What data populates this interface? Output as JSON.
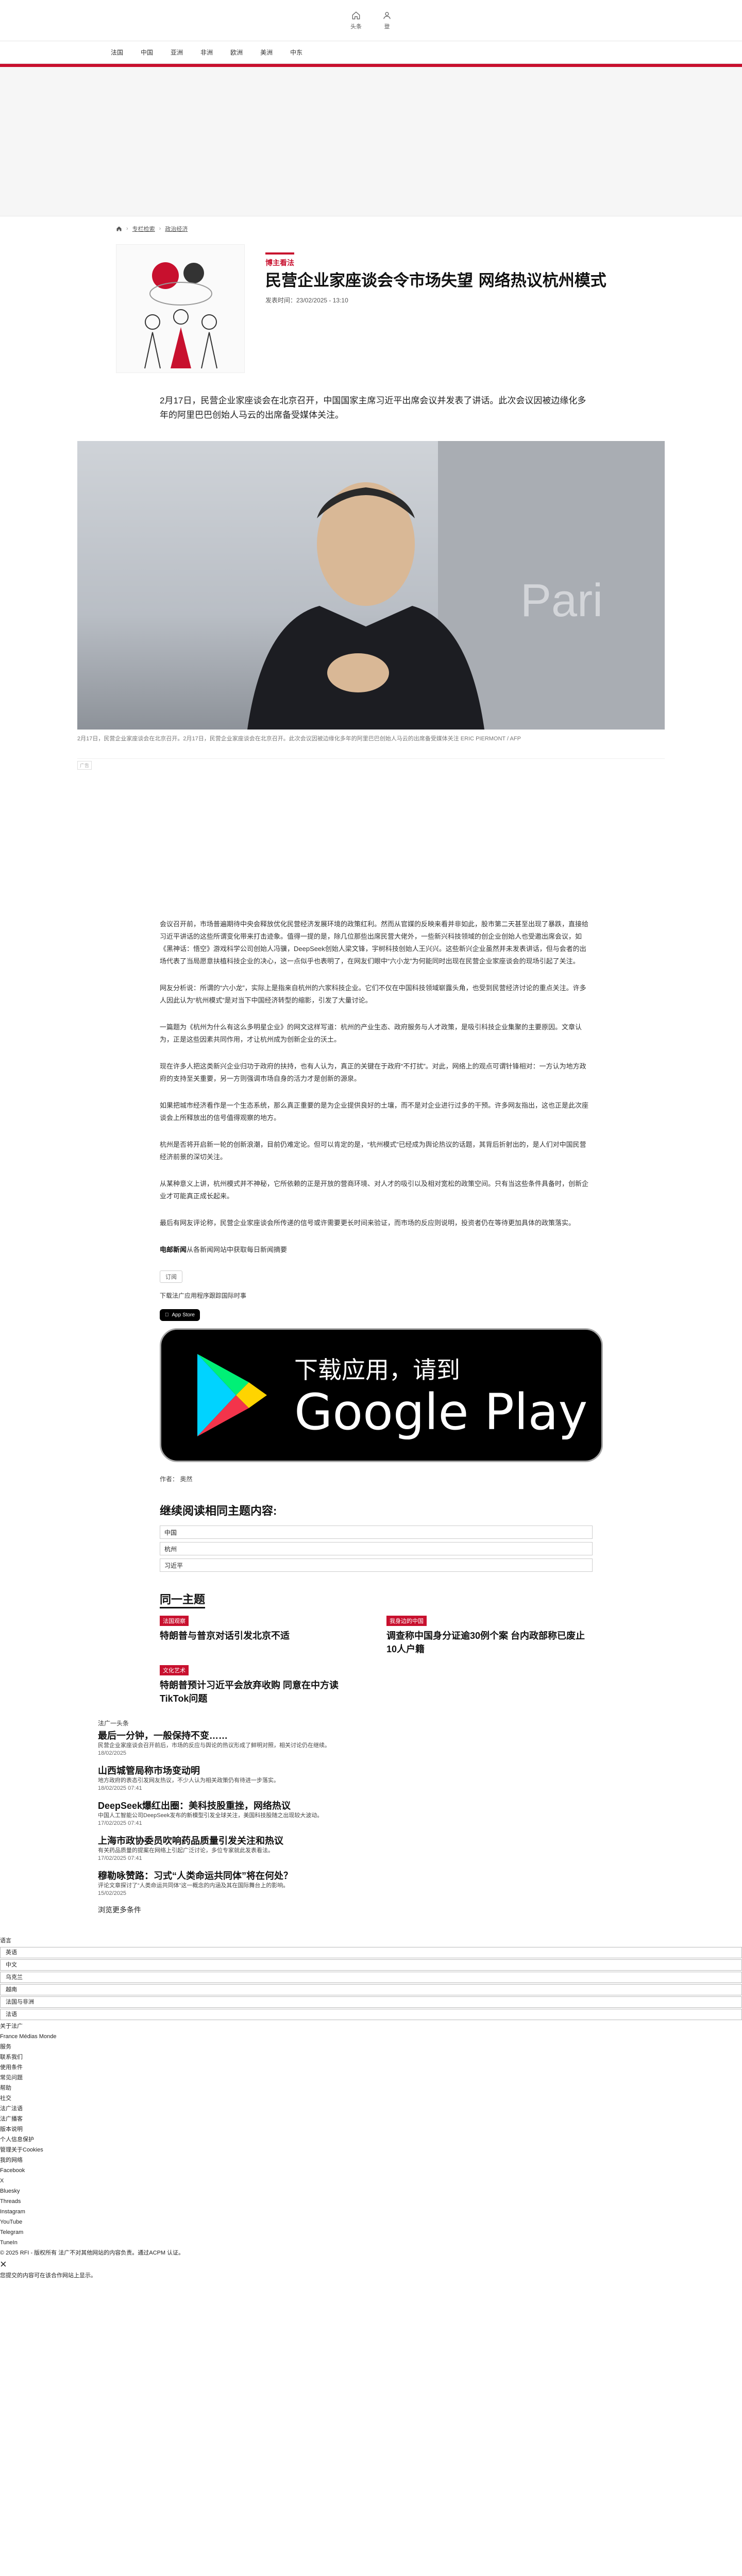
{
  "topbar": {
    "home_label": "头条",
    "account_label": "登"
  },
  "nav": [
    "法国",
    "中国",
    "亚洲",
    "非洲",
    "欧洲",
    "美洲",
    "中东"
  ],
  "breadcrumb": {
    "home": "专栏检索",
    "section": "政治经济"
  },
  "article": {
    "kicker": "博主看法",
    "headline": "民营企业家座谈会令市场失望 网络热议杭州模式",
    "pubdate": "发表时间：23/02/2025 - 13:10",
    "lede": "2月17日，民营企业家座谈会在北京召开，中国国家主席习近平出席会议并发表了讲话。此次会议因被边缘化多年的阿里巴巴创始人马云的出席备受媒体关注。",
    "photo_caption": "2月17日，民营企业家座谈会在北京召开。2月17日，民营企业家座谈会在北京召开。此次会议因被边缘化多年的阿里巴巴创始人马云的出席备受媒体关注 ERIC PIERMONT / AFP",
    "ad_label": "广告",
    "paragraphs": [
      "会议召开前，市场普遍期待中央会释放优化民营经济发展环境的政策红利。然而从官媒的反映来看并非如此，股市第二天甚至出现了暴跌，直接给习近平讲话的这些所谓变化带来打击迹象。值得一提的是，除几位那些出席民营大佬外，一些新兴科技领域的创企业创始人也受邀出席会议，如《黑神话：悟空》游戏科学公司创始人冯骥，DeepSeek创始人梁文锋，宇树科技创始人王兴兴。这些新兴企业虽然并未发表讲话，但与会者的出场代表了当局愿意扶植科技企业的决心，这一点似乎也表明了，在网友们眼中“六小龙”为何能同时出现在民营企业家座谈会的现场引起了关注。",
      "网友分析说：所谓的“六小龙”，实际上是指来自杭州的六家科技企业。它们不仅在中国科技领域崭露头角，也受到民营经济讨论的重点关注。许多人因此认为“杭州模式”是对当下中国经济转型的缩影，引发了大量讨论。",
      "一篇题为《杭州为什么有这么多明星企业》的网文这样写道：杭州的产业生态、政府服务与人才政策，是吸引科技企业集聚的主要原因。文章认为，正是这些因素共同作用，才让杭州成为创新企业的沃土。",
      "现在许多人把这类新兴企业归功于政府的扶持，也有人认为，真正的关键在于政府“不打扰”。对此，网络上的观点可谓针锋相对：一方认为地方政府的支持至关重要，另一方则强调市场自身的活力才是创新的源泉。",
      "如果把城市经济看作是一个生态系统，那么真正重要的是为企业提供良好的土壤，而不是对企业进行过多的干预。许多网友指出，这也正是此次座谈会上所释放出的信号值得观察的地方。",
      "杭州是否将开启新一轮的创新浪潮，目前仍难定论。但可以肯定的是，“杭州模式”已经成为舆论热议的话题，其背后折射出的，是人们对中国民营经济前景的深切关注。",
      "从某种意义上讲，杭州模式并不神秘，它所依赖的正是开放的营商环境、对人才的吸引以及相对宽松的政策空间。只有当这些条件具备时，创新企业才可能真正成长起来。",
      "最后有网友评论称，民营企业家座谈会所传递的信号或许需要更长时间来验证，而市场的反应则说明，投资者仍在等待更加具体的政策落实。"
    ],
    "tail": "电邮新闻",
    "tail_rest": "从各新闻网站中获取每日新闻摘要",
    "follow_label": "订阅",
    "download_label": "下载法广应用程序跟踪国际时事",
    "appstore_label": "App Store",
    "gplay_small": "下载应用，请到",
    "gplay_big": "Google Play",
    "author": "作者： 奥然"
  },
  "related": {
    "title": "继续阅读相同主题内容:",
    "topics": [
      "中国",
      "杭州",
      "习近平"
    ]
  },
  "same_topic": {
    "title": "同一主题",
    "items": [
      {
        "tag": "法国观察",
        "title": "特朗普与普京对话引发北京不适"
      },
      {
        "tag": "我身边的中国",
        "title": "调查称中国身分证逾30例个案 台内政部称已废止10人户籍"
      },
      {
        "tag": "文化艺术",
        "title": "特朗普预计习近平会放弃收购 同意在中方读TikTok问题"
      }
    ]
  },
  "feed": {
    "header": "法广一头条",
    "items": [
      {
        "title": "最后一分钟，一般保持不变……",
        "desc": "民营企业家座谈会召开前后，市场的反应与舆论的热议形成了鲜明对照，相关讨论仍在继续。",
        "date": "18/02/2025"
      },
      {
        "title": "山西城管局称市场变动明",
        "desc": "地方政府的表态引发网友热议，不少人认为相关政策仍有待进一步落实。",
        "date": "18/02/2025 07:41"
      },
      {
        "title": "DeepSeek爆红出圈：美科技股重挫，网络热议",
        "desc": "中国人工智能公司DeepSeek发布的新模型引发全球关注，美国科技股随之出现较大波动。",
        "date": "17/02/2025 07:41"
      },
      {
        "title": "上海市政协委员吹响药品质量引发关注和热议",
        "desc": "有关药品质量的提案在网络上引起广泛讨论，多位专家就此发表看法。",
        "date": "17/02/2025 07:41"
      },
      {
        "title": "穆勒咏赞路：习式“人类命运共同体”将在何处？",
        "desc": "评论文章探讨了“人类命运共同体”这一概念的内涵及其在国际舞台上的影响。",
        "date": "15/02/2025"
      }
    ],
    "more_label": "浏览更多条件"
  },
  "footer": {
    "items": [
      "语言",
      "英语",
      "中文",
      "乌克兰",
      "越南",
      "法国与非洲",
      "法语",
      "关于法广",
      "France Médias Monde",
      "服务",
      "联系我们",
      "使用条件",
      "常见问题",
      "帮助",
      "社交",
      "法广法语",
      "法广播客",
      "版本说明",
      "个人信息保护",
      "管理关于Cookies",
      "我的网络",
      "Facebook",
      "X",
      "Bluesky",
      "Threads",
      "Instagram",
      "YouTube",
      "Telegram",
      "TuneIn"
    ],
    "copyright": "© 2025 RFI - 版权所有 法广不对其他网站的内容负责。通过ACPM 认证。",
    "footnote": "您提交的内容可在该合作网站上显示。"
  }
}
